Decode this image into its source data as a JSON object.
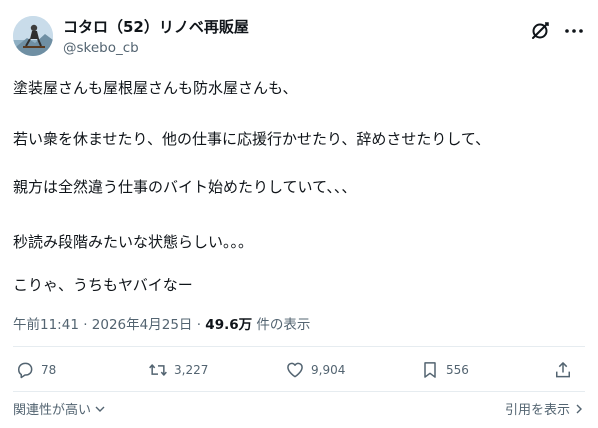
{
  "post": {
    "author": {
      "display_name": "コタロ（52）リノベ再販屋",
      "handle": "@skebo_cb"
    },
    "text_lines": [
      "塗装屋さんも屋根屋さんも防水屋さんも、",
      "若い衆を休ませたり、他の仕事に応援行かせたり、辞めさせたりして、",
      "親方は全然違う仕事のバイト始めたりしていて、、、",
      "秒読み段階みたいな状態らしい。。。",
      "こりゃ、うちもヤバイなー"
    ],
    "timestamp": "午前11:41 · 2026年4月25日 ·",
    "views_count": "49.6万",
    "views_label": "件の表示"
  },
  "actions": {
    "reply_count": "78",
    "retweet_count": "3,227",
    "like_count": "9,904",
    "bookmark_count": "556"
  },
  "footer": {
    "sort_label": "関連性が高い",
    "quotes_label": "引用を表示"
  },
  "icons": {
    "grok": "grok-icon",
    "more": "more-icon",
    "reply": "reply-icon",
    "retweet": "retweet-icon",
    "like": "heart-icon",
    "bookmark": "bookmark-icon",
    "share": "share-icon"
  },
  "colors": {
    "text": "#0f1419",
    "secondary": "#536471",
    "divider": "#e6ecf0"
  }
}
